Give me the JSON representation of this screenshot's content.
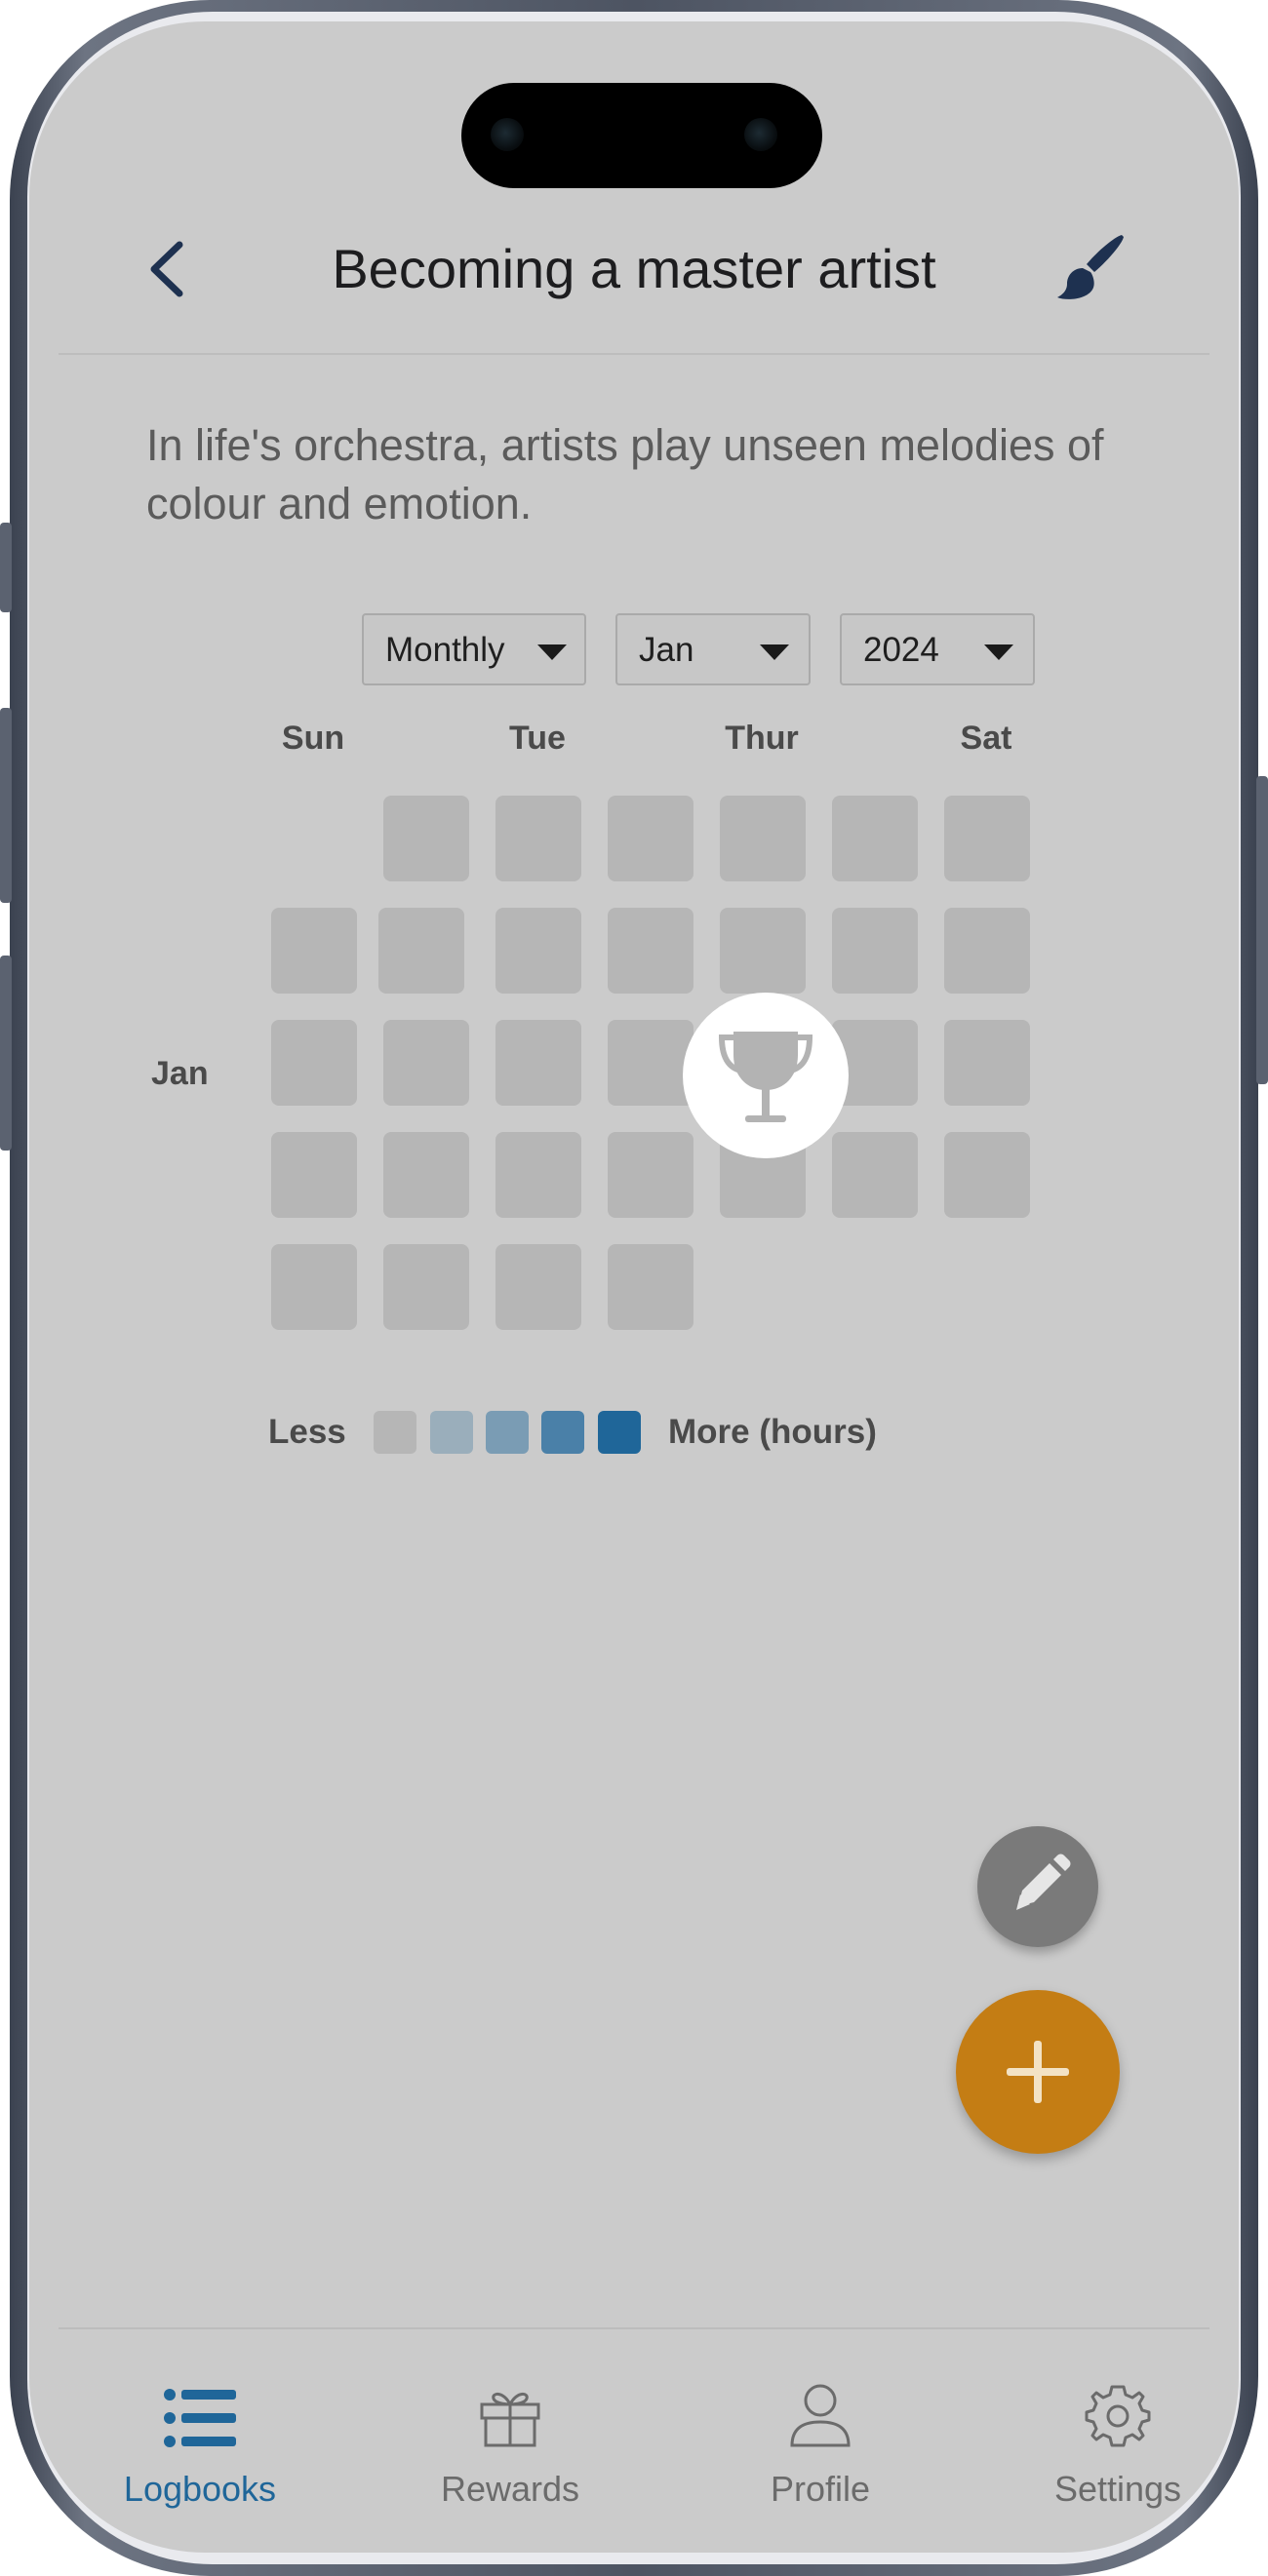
{
  "header": {
    "title": "Becoming a master artist",
    "back_icon": "chevron-left-icon",
    "action_icon": "paint-brush-icon"
  },
  "quote": "In life's orchestra, artists play unseen melodies of colour and emotion.",
  "filters": {
    "period": "Monthly",
    "month": "Jan",
    "year": "2024"
  },
  "calendar": {
    "weekday_labels": [
      "Sun",
      "Tue",
      "Thur",
      "Sat"
    ],
    "month_label": "Jan",
    "trophy_icon": "trophy-icon"
  },
  "legend": {
    "less": "Less",
    "more": "More (hours)",
    "colors": [
      "#b6b6b6",
      "#9aaebb",
      "#7a9cb4",
      "#4a80a8",
      "#1f6699"
    ]
  },
  "fabs": {
    "edit_icon": "pencil-icon",
    "add_icon": "plus-icon"
  },
  "nav": {
    "items": [
      {
        "label": "Logbooks",
        "icon": "list-icon",
        "active": true
      },
      {
        "label": "Rewards",
        "icon": "gift-icon",
        "active": false
      },
      {
        "label": "Profile",
        "icon": "user-icon",
        "active": false
      },
      {
        "label": "Settings",
        "icon": "gear-icon",
        "active": false
      }
    ]
  },
  "colors": {
    "accent": "#1f6699",
    "fab_orange": "#c47d14",
    "background": "#cbcbcb"
  }
}
